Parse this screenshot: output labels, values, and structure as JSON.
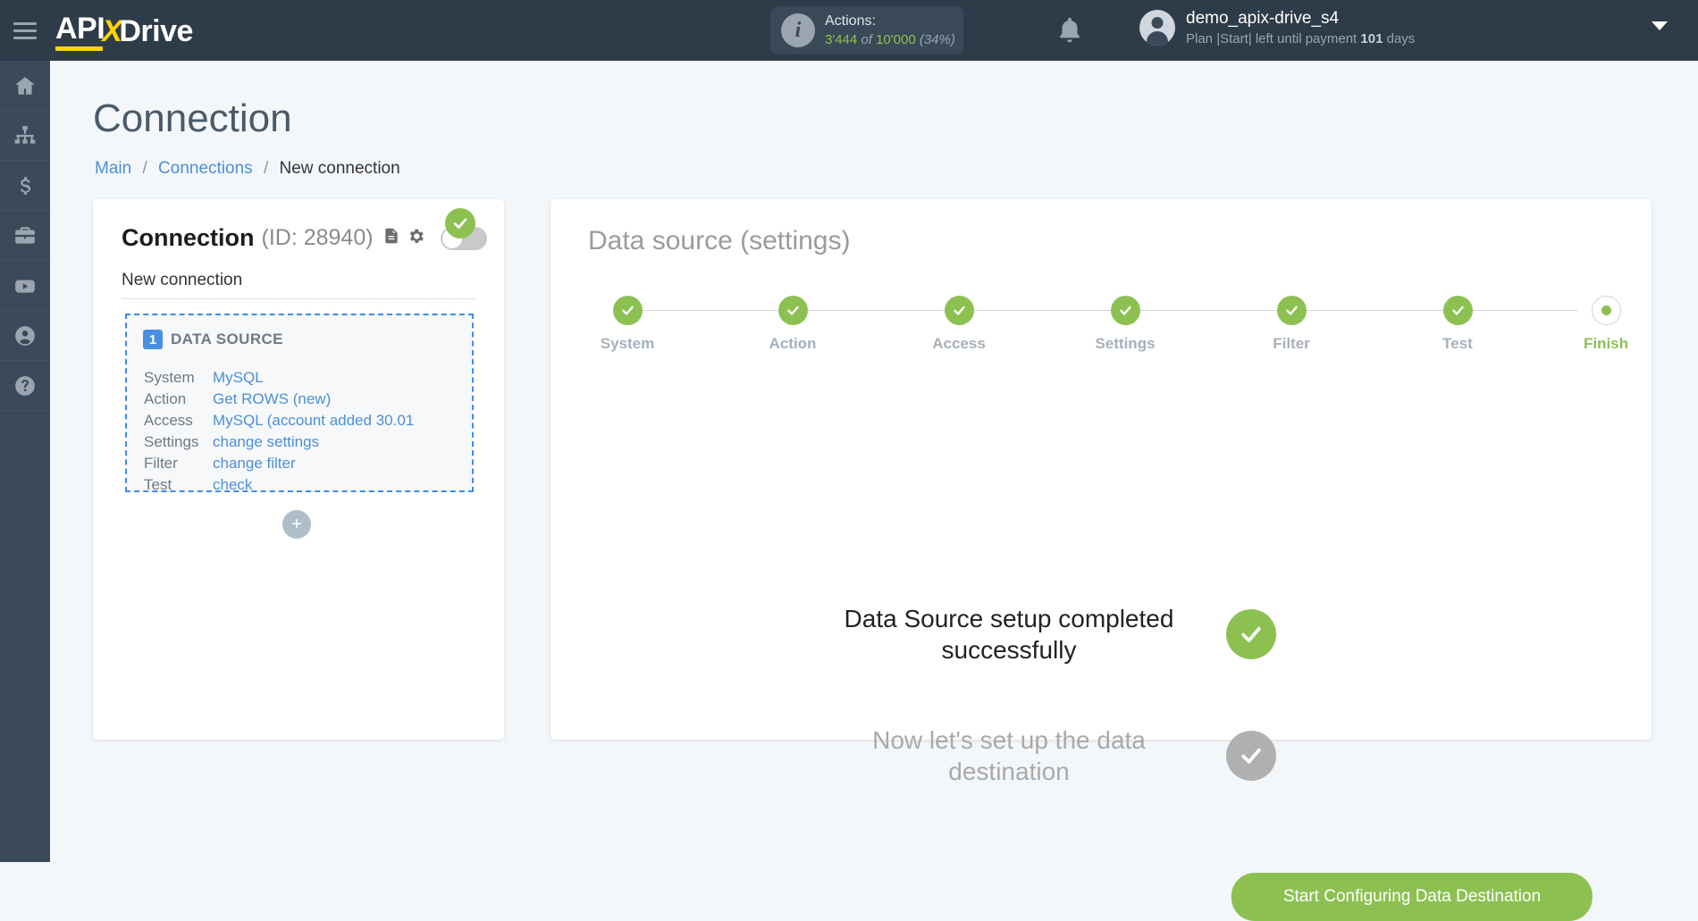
{
  "header": {
    "logo": {
      "part1": "API",
      "x": "X",
      "part2": "Drive"
    },
    "menu_icon": "hamburger-icon",
    "actions": {
      "label": "Actions:",
      "used": "3'444",
      "of": "of",
      "total": "10'000",
      "percent": "(34%)"
    },
    "user": {
      "name": "demo_apix-drive_s4",
      "plan_prefix": "Plan |Start| left until payment",
      "days": "101",
      "plan_suffix": "days"
    }
  },
  "sidebar": {
    "items": [
      {
        "name": "home",
        "label": "Home"
      },
      {
        "name": "connections",
        "label": "Connections"
      },
      {
        "name": "billing",
        "label": "Billing"
      },
      {
        "name": "briefcase",
        "label": "Business"
      },
      {
        "name": "video",
        "label": "Video"
      },
      {
        "name": "account",
        "label": "Account"
      },
      {
        "name": "help",
        "label": "Help"
      }
    ]
  },
  "page": {
    "title": "Connection",
    "breadcrumb": {
      "main": "Main",
      "connections": "Connections",
      "current": "New connection",
      "separator": "/"
    }
  },
  "connection_card": {
    "title": "Connection",
    "id_label": "(ID: 28940)",
    "name": "New connection",
    "enabled": false,
    "data_source": {
      "number": "1",
      "heading": "DATA SOURCE",
      "rows": [
        {
          "key": "System",
          "value": "MySQL"
        },
        {
          "key": "Action",
          "value": "Get ROWS (new)"
        },
        {
          "key": "Access",
          "value": "MySQL (account added 30.01"
        },
        {
          "key": "Settings",
          "value": "change settings"
        },
        {
          "key": "Filter",
          "value": "change filter"
        },
        {
          "key": "Test",
          "value": "check"
        }
      ]
    },
    "add_label": "+"
  },
  "panel": {
    "title_main": "Data source",
    "title_sub": "(settings)",
    "steps": [
      {
        "label": "System",
        "state": "done"
      },
      {
        "label": "Action",
        "state": "done"
      },
      {
        "label": "Access",
        "state": "done"
      },
      {
        "label": "Settings",
        "state": "done"
      },
      {
        "label": "Filter",
        "state": "done"
      },
      {
        "label": "Test",
        "state": "done"
      },
      {
        "label": "Finish",
        "state": "current"
      }
    ],
    "message_success": "Data Source setup completed successfully",
    "message_next": "Now let's set up the data destination",
    "cta_label": "Start Configuring Data Destination"
  },
  "colors": {
    "green": "#8cc152",
    "blue": "#4a90d9",
    "dark": "#2e3b48",
    "nav": "#3b4a58",
    "yellow": "#ffd400"
  }
}
